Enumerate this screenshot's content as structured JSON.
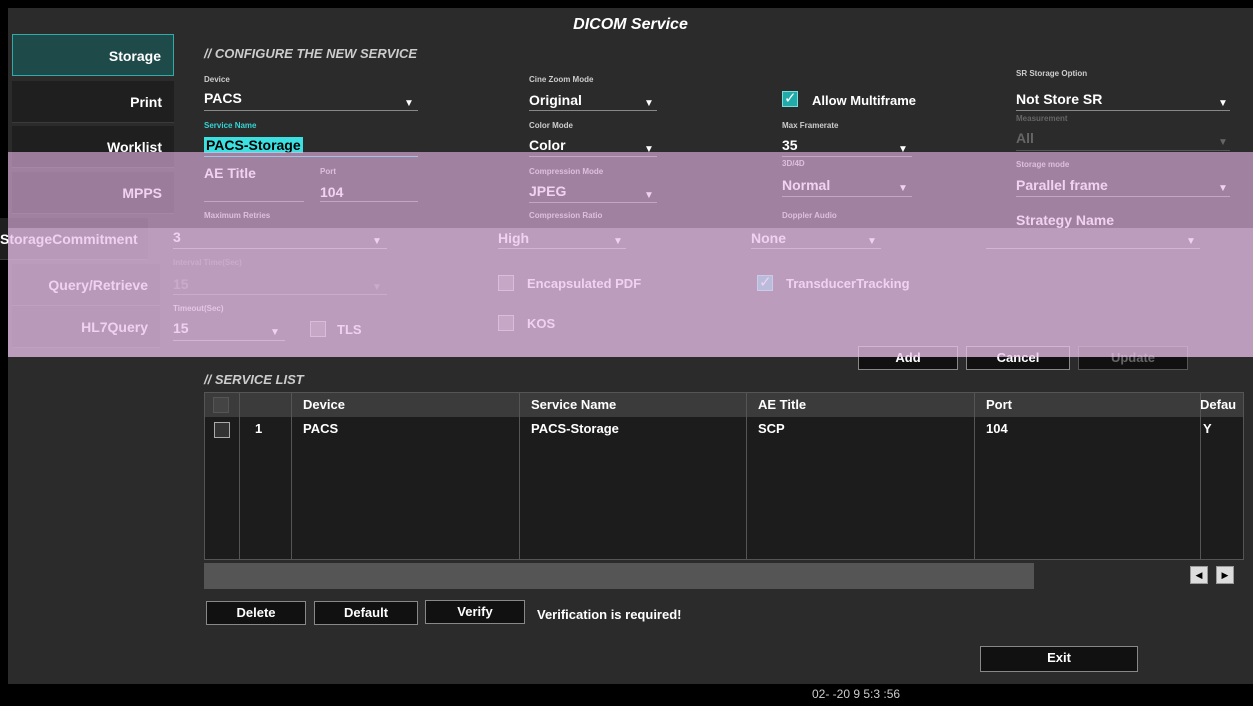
{
  "window": {
    "title": "DICOM Service"
  },
  "sidebar": {
    "items": [
      {
        "label": "Storage"
      },
      {
        "label": "Print"
      },
      {
        "label": "Worklist"
      },
      {
        "label": "MPPS"
      },
      {
        "label": "StorageCommitment"
      },
      {
        "label": "Query/Retrieve"
      },
      {
        "label": "HL7Query"
      }
    ]
  },
  "config": {
    "section_title": "CONFIGURE THE NEW SERVICE",
    "device": {
      "label": "Device",
      "value": "PACS"
    },
    "service_name": {
      "label": "Service Name",
      "value": "PACS-Storage"
    },
    "ae_title": {
      "label": "AE Title",
      "value": ""
    },
    "port": {
      "label": "Port",
      "value": "104"
    },
    "max_retries": {
      "label": "Maximum Retries",
      "value": "3"
    },
    "interval": {
      "label": "Interval Time(Sec)",
      "value": "15"
    },
    "timeout": {
      "label": "Timeout(Sec)",
      "value": "15"
    },
    "tls": {
      "label": "TLS",
      "checked": false
    },
    "cine_zoom": {
      "label": "Cine Zoom Mode",
      "value": "Original"
    },
    "color_mode": {
      "label": "Color Mode",
      "value": "Color"
    },
    "compression_mode": {
      "label": "Compression Mode",
      "value": "JPEG"
    },
    "compression_ratio": {
      "label": "Compression Ratio",
      "value": "High"
    },
    "encapsulated_pdf": {
      "label": "Encapsulated PDF",
      "checked": false
    },
    "kos": {
      "label": "KOS",
      "checked": false
    },
    "allow_multiframe": {
      "label": "Allow Multiframe",
      "checked": true
    },
    "max_framerate": {
      "label": "Max Framerate",
      "value": "35"
    },
    "threed": {
      "label": "3D/4D",
      "value": "Normal"
    },
    "doppler_audio": {
      "label": "Doppler Audio",
      "value": "None"
    },
    "transducer_tracking": {
      "label": "TransducerTracking",
      "checked": true
    },
    "sr_storage": {
      "label": "SR Storage Option",
      "value": "Not Store SR"
    },
    "measurement": {
      "label": "Measurement",
      "value": "All"
    },
    "storage_mode": {
      "label": "Storage mode",
      "value": "Parallel frame"
    },
    "strategy_name": {
      "label": "Strategy Name",
      "value": ""
    }
  },
  "actions": {
    "add": "Add",
    "cancel": "Cancel",
    "update": "Update"
  },
  "service_list": {
    "section_title": "SERVICE LIST",
    "columns": [
      "Device",
      "Service Name",
      "AE Title",
      "Port",
      "Defau"
    ],
    "rows": [
      {
        "index": "1",
        "device": "PACS",
        "service_name": "PACS-Storage",
        "ae_title": "SCP",
        "port": "104",
        "default": "Y"
      }
    ]
  },
  "footer": {
    "delete": "Delete",
    "default": "Default",
    "verify": "Verify",
    "verification_msg": "Verification is required!",
    "exit": "Exit"
  },
  "statusbar": {
    "datetime": "02- -20 9 5:3 :56"
  },
  "colors": {
    "accent": "#35d4d4",
    "overlay": "#e8b8e8"
  }
}
